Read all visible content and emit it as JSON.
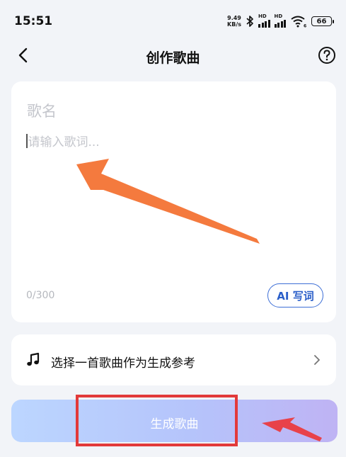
{
  "status_bar": {
    "time": "15:51",
    "net_speed_value": "9.49",
    "net_speed_unit": "KB/s",
    "sim1_label": "HD",
    "sim2_label": "HD",
    "wifi_label": "6",
    "battery": "66"
  },
  "nav": {
    "title": "创作歌曲",
    "back_icon": "chevron-left-icon",
    "help_icon": "question-circle-icon"
  },
  "editor": {
    "song_name_placeholder": "歌名",
    "lyrics_placeholder": "请输入歌词...",
    "char_count": "0/300",
    "ai_button_label": "AI 写词"
  },
  "reference": {
    "icon": "music-note-icon",
    "label": "选择一首歌曲作为生成参考",
    "chevron": "chevron-right-icon"
  },
  "generate": {
    "label": "生成歌曲"
  },
  "colors": {
    "background": "#f2f4f8",
    "accent_blue": "#2b5fc9",
    "annotation_arrow": "#f47a3e",
    "annotation_highlight": "#e23a3a",
    "annotation_arrow_small": "#e8424a"
  }
}
